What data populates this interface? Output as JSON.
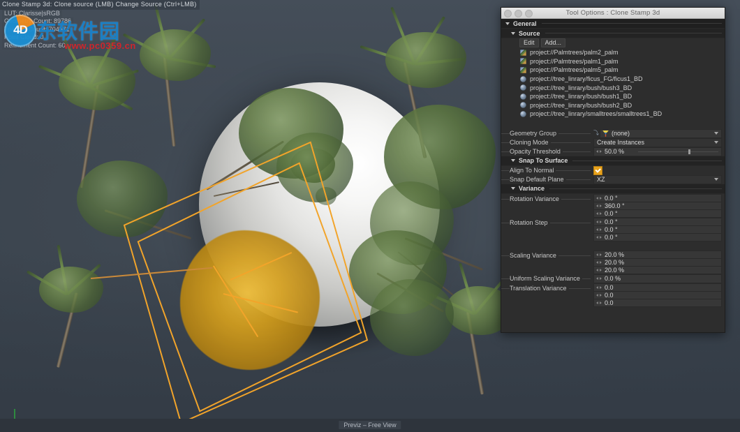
{
  "hud": {
    "tool_line": "Clone Stamp 3d: Clone source (LMB)  Change Source (Ctrl+LMB)",
    "lut_line": "LUT: Clarisse|sRGB",
    "geometry_count": "Geometry Count: 89786",
    "triangle_count": "Triangle Count: 704571",
    "point_cloud": "Point Cloud: 0",
    "refinement_count": "Refinement Count: 60"
  },
  "watermark": {
    "logo_text": "4D",
    "brand": "东软件园",
    "url": "www.pc0359.cn"
  },
  "statusbar": {
    "view_label": "Previz – Free View"
  },
  "panel": {
    "title": "Tool Options : Clone Stamp 3d",
    "sections": {
      "general": "General",
      "source": "Source",
      "snap_to_surface": "Snap To Surface",
      "variance": "Variance"
    },
    "buttons": {
      "edit": "Edit",
      "add": "Add..."
    },
    "source_items": [
      {
        "icon": "leaf-thumbnail-icon",
        "path": "project://Palmtrees/palm2_palm"
      },
      {
        "icon": "leaf-thumbnail-icon",
        "path": "project://Palmtrees/palm1_palm"
      },
      {
        "icon": "leaf-thumbnail-icon",
        "path": "project://Palmtrees/palm5_palm"
      },
      {
        "icon": "sphere-geometry-icon",
        "path": "project://tree_linrary/ficus_FG/ficus1_BD"
      },
      {
        "icon": "sphere-geometry-icon",
        "path": "project://tree_linrary/bush/bush3_BD"
      },
      {
        "icon": "sphere-geometry-icon",
        "path": "project://tree_linrary/bush/bush1_BD"
      },
      {
        "icon": "sphere-geometry-icon",
        "path": "project://tree_linrary/bush/bush2_BD"
      },
      {
        "icon": "sphere-geometry-icon",
        "path": "project://tree_linrary/smalltrees/smalltrees1_BD"
      }
    ],
    "properties": {
      "geometry_group": {
        "label": "Geometry Group",
        "value": "(none)"
      },
      "cloning_mode": {
        "label": "Cloning Mode",
        "value": "Create Instances"
      },
      "opacity_threshold": {
        "label": "Opacity Threshold",
        "value": "50.0 %"
      },
      "align_to_normal": {
        "label": "Align To Normal",
        "checked": true
      },
      "snap_default_plane": {
        "label": "Snap Default Plane",
        "value": "XZ"
      },
      "rotation_variance": {
        "label": "Rotation Variance",
        "values": [
          "0.0 °",
          "360.0 °",
          "0.0 °"
        ]
      },
      "rotation_step": {
        "label": "Rotation Step",
        "values": [
          "0.0 °",
          "0.0 °",
          "0.0 °"
        ]
      },
      "scaling_variance": {
        "label": "Scaling Variance",
        "values": [
          "20.0 %",
          "20.0 %",
          "20.0 %"
        ]
      },
      "uniform_scaling_variance": {
        "label": "Uniform Scaling Variance",
        "value": "0.0 %"
      },
      "translation_variance": {
        "label": "Translation Variance",
        "values": [
          "0.0",
          "0.0",
          "0.0"
        ]
      }
    }
  },
  "colors": {
    "accent_orange": "#f2a42a",
    "checkbox_orange": "#e8a21c",
    "viewport_bg": "#3f4852",
    "panel_bg": "#2d2d2d"
  }
}
